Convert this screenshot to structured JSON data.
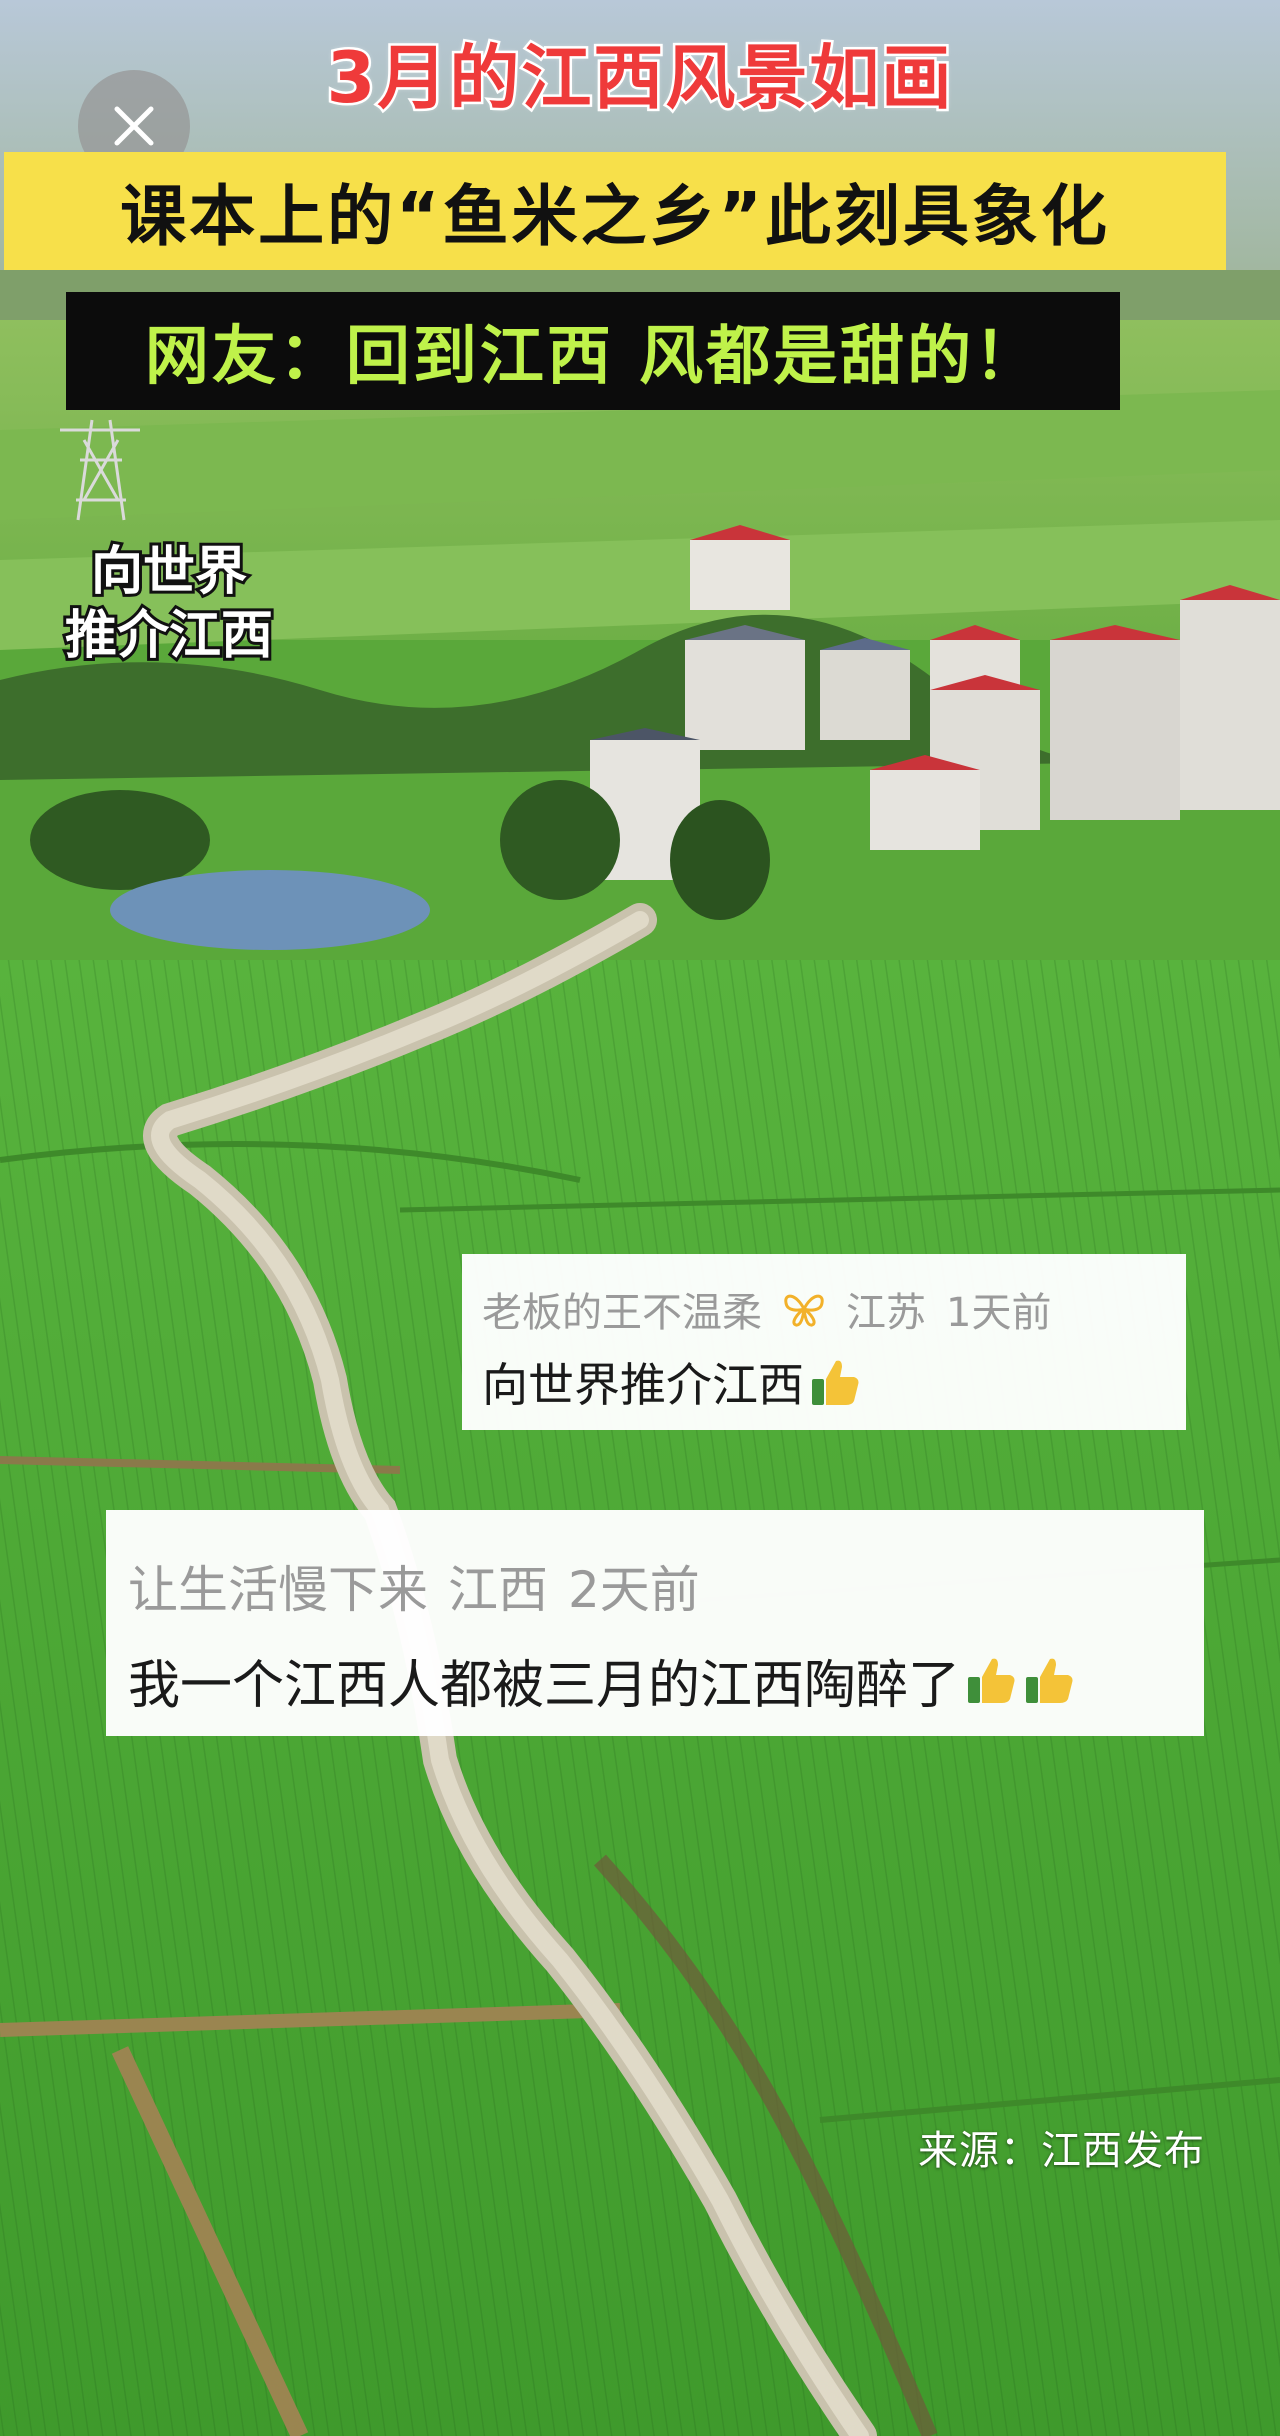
{
  "close": {
    "icon": "close-icon"
  },
  "headline": {
    "title": "3月的江西风景如画",
    "subtitle": "课本上的“鱼米之乡”此刻具象化",
    "netizen_quote": "网友：回到江西 风都是甜的！"
  },
  "promo_caption": {
    "line1": "向世界",
    "line2": "推介江西"
  },
  "comments": [
    {
      "username": "老板的王不温柔",
      "badge_icon": "butterfly-icon",
      "location": "江苏",
      "time": "1天前",
      "text": "向世界推介江西",
      "emoji": [
        "thumbs-up-icon"
      ]
    },
    {
      "username": "让生活慢下来",
      "location": "江西",
      "time": "2天前",
      "text": "我一个江西人都被三月的江西陶醉了",
      "emoji": [
        "thumbs-up-icon",
        "thumbs-up-icon"
      ]
    }
  ],
  "source": "来源：江西发布",
  "colors": {
    "title_red": "#ef3a3a",
    "subtitle_bg": "#f7e04a",
    "quote_bg": "#0c0c0c",
    "quote_text": "#bff24a",
    "field_green": "#5aa83a"
  }
}
